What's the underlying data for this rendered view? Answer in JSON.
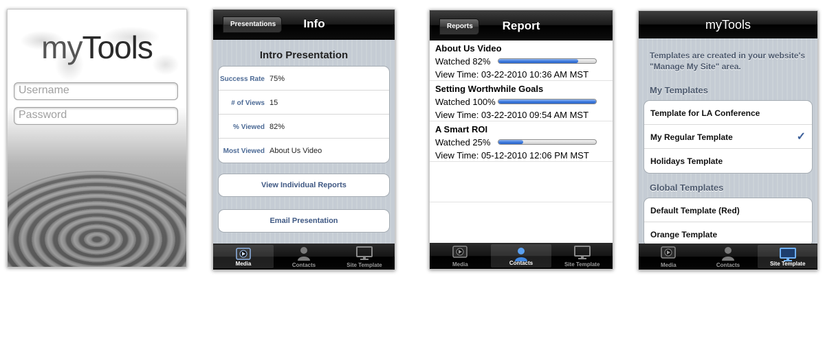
{
  "login": {
    "logo_light": "my",
    "logo_bold": "Tools",
    "username_placeholder": "Username",
    "password_placeholder": "Password"
  },
  "info": {
    "back_label": "Presentations",
    "title": "Info",
    "section_title": "Intro Presentation",
    "stats": [
      {
        "label": "Success Rate",
        "value": "75%"
      },
      {
        "label": "# of Views",
        "value": "15"
      },
      {
        "label": "% Viewed",
        "value": "82%"
      },
      {
        "label": "Most Viewed",
        "value": "About Us Video"
      }
    ],
    "view_reports_label": "View Individual Reports",
    "email_label": "Email Presentation"
  },
  "report": {
    "back_label": "Reports",
    "title": "Report",
    "items": [
      {
        "title": "About Us Video",
        "watched": "Watched 82%",
        "progress": 0.82,
        "view_time": "View Time: 03-22-2010 10:36 AM MST"
      },
      {
        "title": "Setting Worthwhile Goals",
        "watched": "Watched 100%",
        "progress": 1.0,
        "view_time": "View Time: 03-22-2010 09:54 AM MST"
      },
      {
        "title": "A Smart ROI",
        "watched": "Watched 25%",
        "progress": 0.25,
        "view_time": "View Time: 05-12-2010 12:06 PM MST"
      }
    ]
  },
  "templates": {
    "title": "myTools",
    "description": "Templates are created in your website's \"Manage My Site\" area.",
    "my_header": "My Templates",
    "my_items": [
      "Template for LA Conference",
      "My Regular Template",
      "Holidays Template"
    ],
    "selected_index": 1,
    "global_header": "Global Templates",
    "global_items": [
      "Default Template (Red)",
      "Orange Template"
    ]
  },
  "tabs": [
    "Media",
    "Contacts",
    "Site Template"
  ],
  "colors": {
    "accent_blue": "#3b5f9a",
    "progress_blue": "#3a78dd",
    "label_blue": "#4c6a95"
  }
}
